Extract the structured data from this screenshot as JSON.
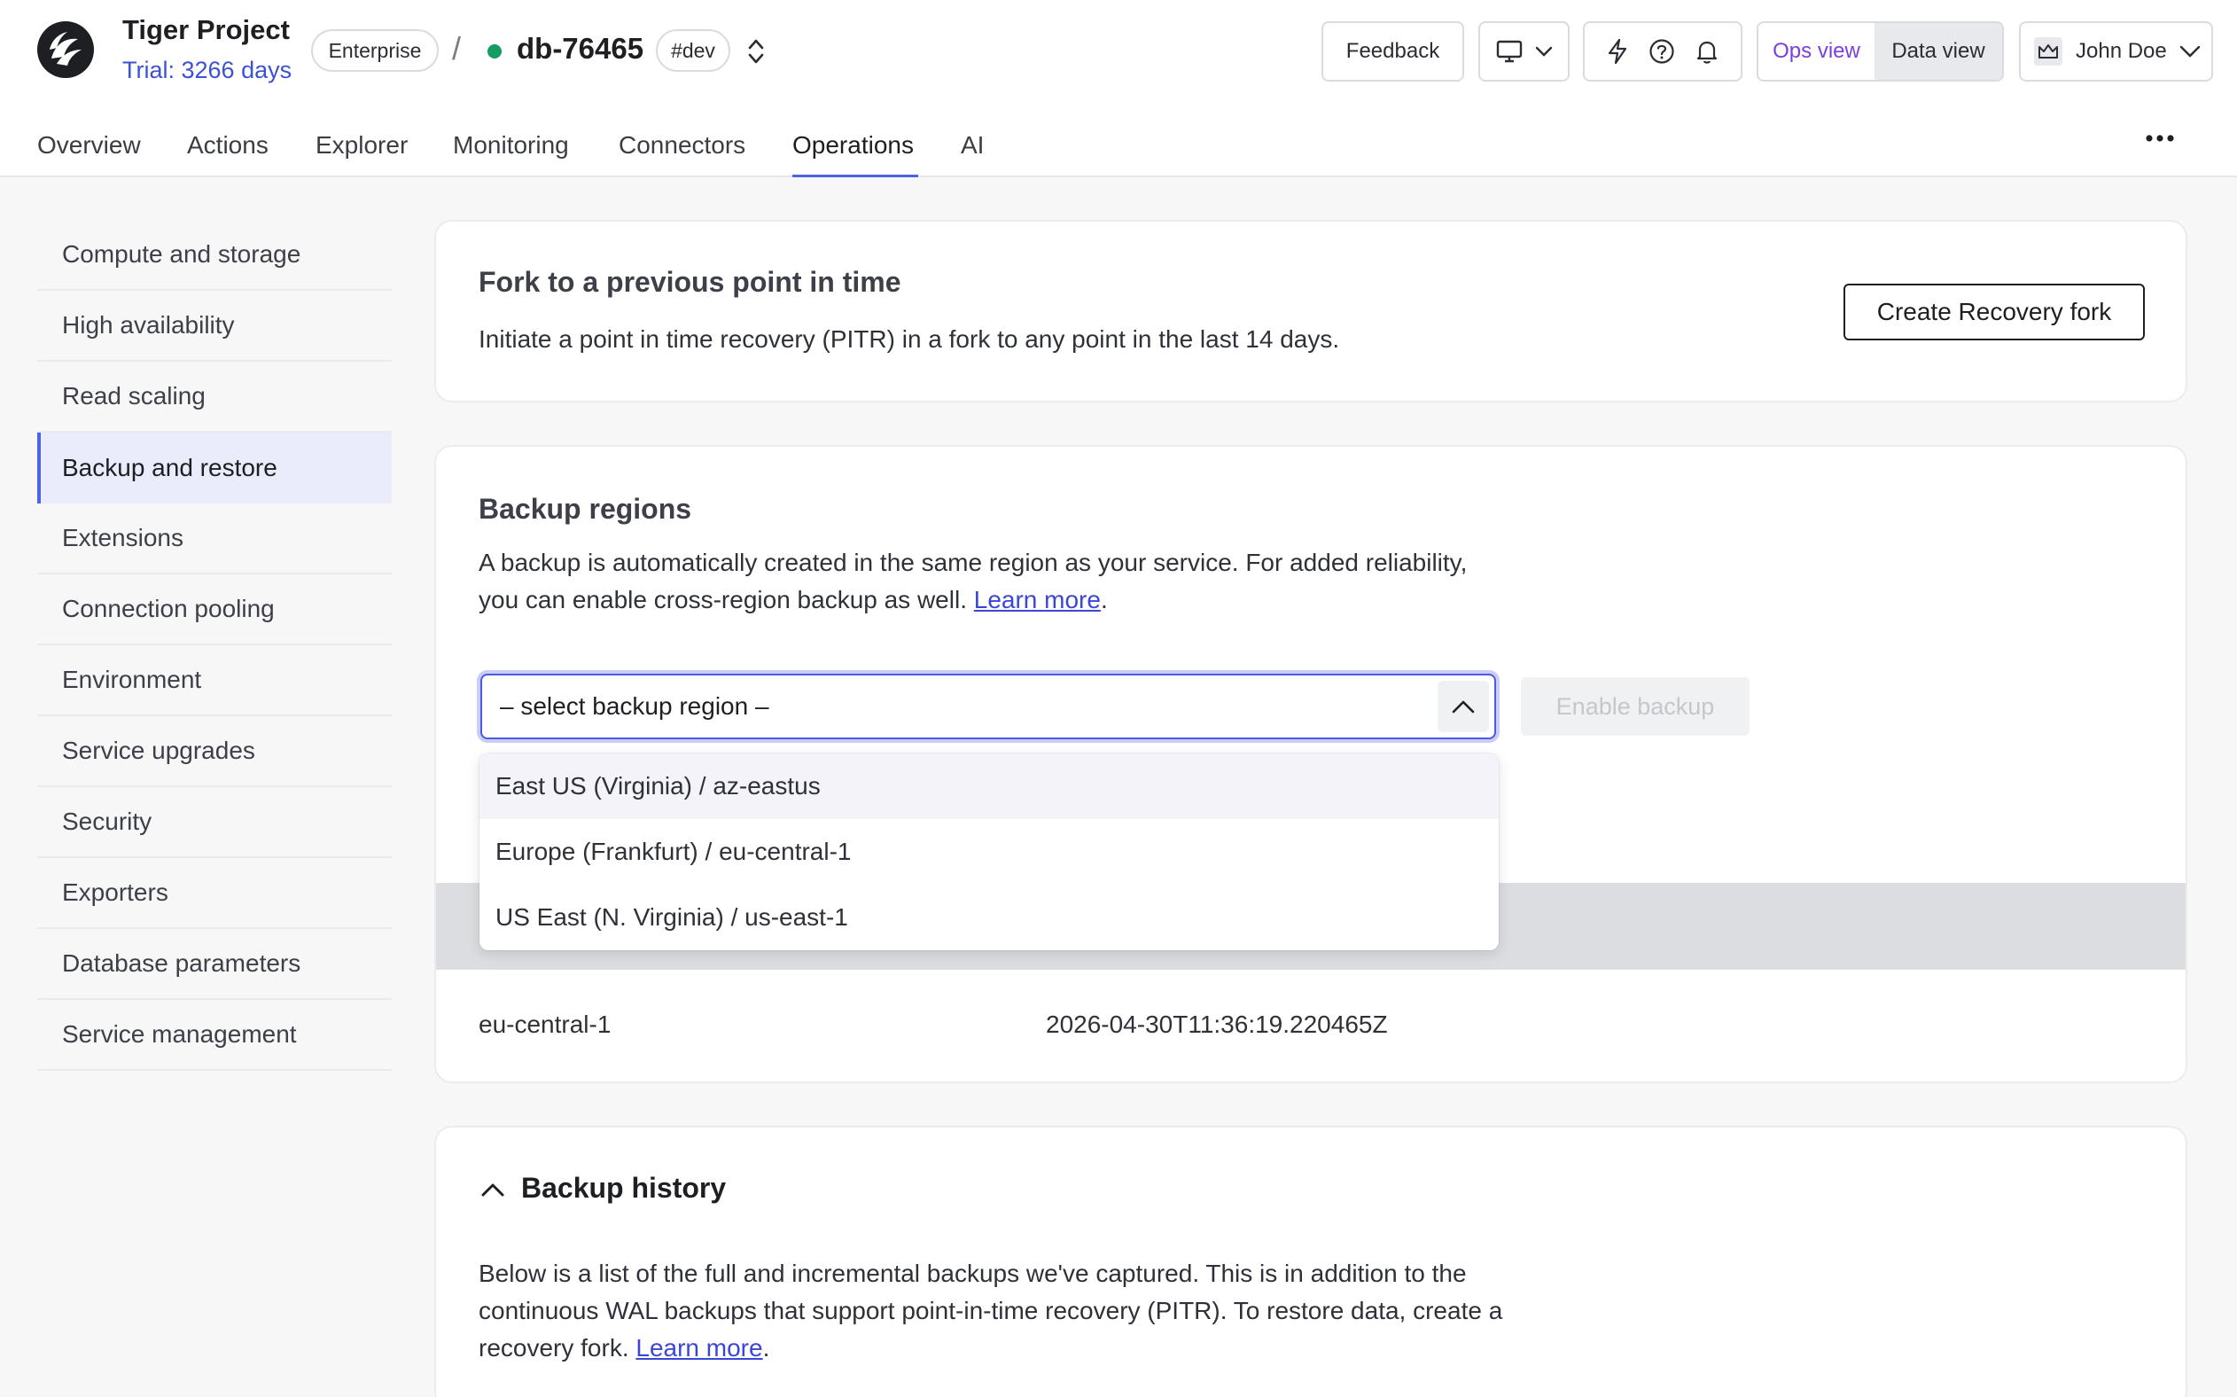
{
  "header": {
    "project_name": "Tiger Project",
    "trial": "Trial: 3266 days",
    "plan_badge": "Enterprise",
    "separator": "/",
    "service_name": "db-76465",
    "env_tag": "#dev",
    "feedback_label": "Feedback",
    "ops_view_label": "Ops view",
    "data_view_label": "Data view",
    "user_name": "John Doe",
    "status_color": "#149c62"
  },
  "tabs": [
    "Overview",
    "Actions",
    "Explorer",
    "Monitoring",
    "Connectors",
    "Operations",
    "AI"
  ],
  "active_tab": "Operations",
  "sidebar": {
    "items": [
      "Compute and storage",
      "High availability",
      "Read scaling",
      "Backup and restore",
      "Extensions",
      "Connection pooling",
      "Environment",
      "Service upgrades",
      "Security",
      "Exporters",
      "Database parameters",
      "Service management"
    ],
    "active": "Backup and restore"
  },
  "pitr": {
    "title": "Fork to a previous point in time",
    "description": "Initiate a point in time recovery (PITR) in a fork to any point in the last 14 days.",
    "button_label": "Create Recovery fork"
  },
  "backup_regions": {
    "title": "Backup regions",
    "description_line1": "A backup is automatically created in the same region as your service. For added reliability,",
    "description_line2_prefix": "you can enable cross-region backup as well. ",
    "learn_more": "Learn more",
    "period": ".",
    "select_placeholder": "– select backup region –",
    "enable_label": "Enable backup",
    "options": [
      "East US (Virginia) / az-eastus",
      "Europe (Frankfurt) / eu-central-1",
      "US East (N. Virginia) / us-east-1"
    ],
    "rows": [
      {
        "region": "eu-central-1",
        "timestamp": "2026-04-30T11:36:19.220465Z"
      }
    ]
  },
  "backup_history": {
    "title": "Backup history",
    "line1": "Below is a list of the full and incremental backups we've captured. This is in addition to the",
    "line2": "continuous WAL backups that support point-in-time recovery (PITR). To restore data, create a",
    "line3_prefix": "recovery fork. ",
    "learn_more": "Learn more",
    "period": "."
  }
}
